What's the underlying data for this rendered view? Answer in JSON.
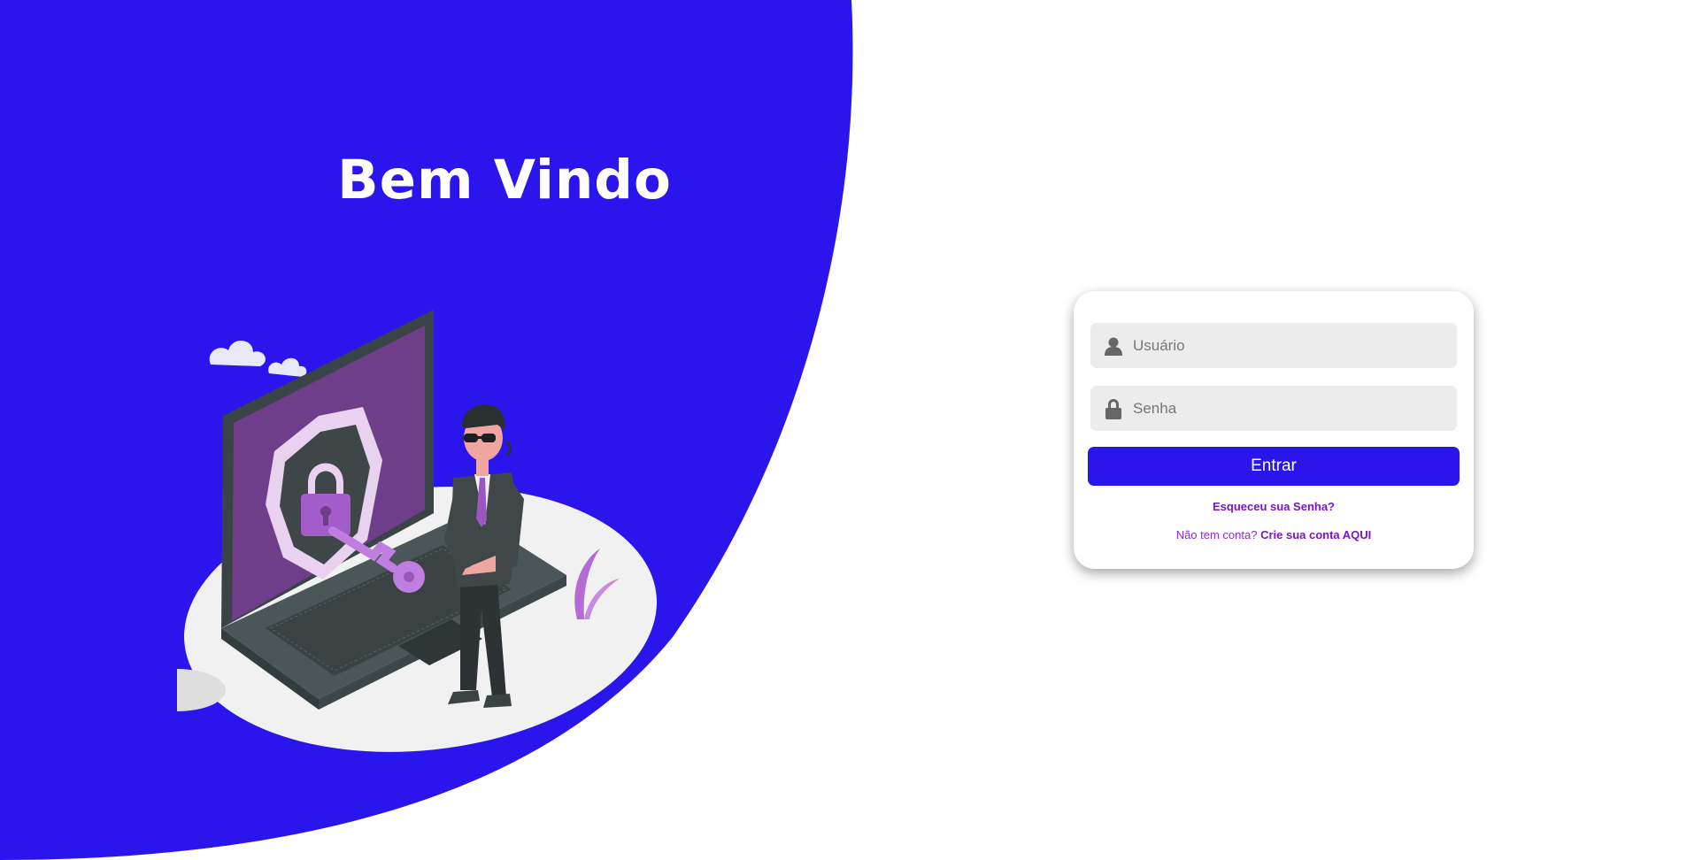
{
  "hero": {
    "title": "Bem Vindo"
  },
  "login": {
    "username_placeholder": "Usuário",
    "password_placeholder": "Senha",
    "submit_label": "Entrar",
    "forgot_link": "Esqueceu sua Senha?",
    "signup_prompt": "Não tem conta?",
    "signup_link": "Crie sua conta AQUI"
  },
  "icons": {
    "username": "user-icon",
    "password": "lock-icon"
  },
  "colors": {
    "brand_blue": "#2a16ec",
    "link_purple": "#7a13c9",
    "field_bg": "#ececec",
    "illustration_purple": "#8e4fb5"
  }
}
